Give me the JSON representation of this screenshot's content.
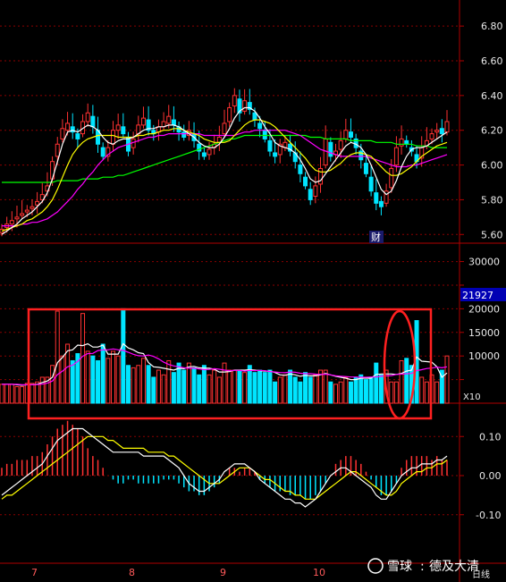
{
  "chart_data": [
    {
      "type": "candlestick",
      "panel": "price",
      "ylim": [
        5.55,
        6.95
      ],
      "y_ticks": [
        "6.80",
        "6.60",
        "6.40",
        "6.20",
        "6.00",
        "5.80",
        "5.60"
      ],
      "colors": {
        "up": "#ff3232",
        "down": "#00e5ff",
        "ma5": "#ffffff",
        "ma10": "#ffff00",
        "ma20": "#ff00ff",
        "ma60": "#00ff00"
      },
      "event_marker": "财",
      "series_close": [
        5.63,
        5.66,
        5.68,
        5.7,
        5.72,
        5.74,
        5.76,
        5.79,
        5.83,
        5.88,
        6.02,
        6.12,
        6.21,
        6.24,
        6.19,
        6.15,
        6.25,
        6.3,
        6.22,
        6.12,
        6.05,
        6.1,
        6.2,
        6.23,
        6.18,
        6.08,
        6.15,
        6.23,
        6.27,
        6.2,
        6.18,
        6.22,
        6.25,
        6.28,
        6.23,
        6.19,
        6.16,
        6.2,
        6.14,
        6.08,
        6.05,
        6.09,
        6.12,
        6.16,
        6.24,
        6.33,
        6.4,
        6.3,
        6.37,
        6.32,
        6.26,
        6.21,
        6.15,
        6.08,
        6.05,
        6.12,
        6.13,
        6.08,
        6.02,
        5.95,
        5.88,
        5.8,
        5.88,
        5.98,
        6.15,
        6.05,
        6.08,
        6.14,
        6.2,
        6.16,
        6.1,
        6.03,
        5.95,
        5.85,
        5.78,
        5.76,
        5.85,
        5.98,
        6.1,
        6.15,
        6.12,
        6.08,
        6.02,
        6.1,
        6.14,
        6.18,
        6.2,
        6.18,
        6.25
      ],
      "series_open": [
        5.61,
        5.64,
        5.66,
        5.69,
        5.71,
        5.73,
        5.75,
        5.77,
        5.8,
        5.85,
        5.92,
        6.05,
        6.15,
        6.2,
        6.22,
        6.18,
        6.18,
        6.25,
        6.28,
        6.2,
        6.1,
        6.05,
        6.12,
        6.2,
        6.22,
        6.16,
        6.1,
        6.18,
        6.23,
        6.26,
        6.2,
        6.19,
        6.22,
        6.24,
        6.26,
        6.22,
        6.19,
        6.17,
        6.18,
        6.12,
        6.07,
        6.06,
        6.1,
        6.13,
        6.18,
        6.25,
        6.34,
        6.38,
        6.31,
        6.36,
        6.3,
        6.24,
        6.2,
        6.14,
        6.07,
        6.06,
        6.1,
        6.12,
        6.07,
        6.0,
        5.93,
        5.86,
        5.82,
        5.89,
        6.0,
        6.13,
        6.06,
        6.09,
        6.15,
        6.19,
        6.15,
        6.08,
        6.01,
        5.93,
        5.84,
        5.79,
        5.78,
        5.87,
        6.0,
        6.11,
        6.14,
        6.1,
        6.06,
        6.04,
        6.11,
        6.15,
        6.19,
        6.21,
        6.19
      ],
      "ma5": [
        5.6,
        5.62,
        5.64,
        5.66,
        5.69,
        5.71,
        5.73,
        5.76,
        5.79,
        5.84,
        5.92,
        6.02,
        6.12,
        6.19,
        6.2,
        6.19,
        6.21,
        6.23,
        6.22,
        6.2,
        6.16,
        6.13,
        6.12,
        6.14,
        6.15,
        6.15,
        6.16,
        6.18,
        6.2,
        6.21,
        6.21,
        6.22,
        6.22,
        6.23,
        6.23,
        6.22,
        6.2,
        6.18,
        6.16,
        6.13,
        6.11,
        6.1,
        6.1,
        6.12,
        6.16,
        6.21,
        6.27,
        6.31,
        6.33,
        6.33,
        6.31,
        6.27,
        6.22,
        6.18,
        6.13,
        6.11,
        6.1,
        6.09,
        6.07,
        6.03,
        5.98,
        5.92,
        5.9,
        5.91,
        5.95,
        5.99,
        6.03,
        6.07,
        6.11,
        6.13,
        6.12,
        6.1,
        6.06,
        6.0,
        5.93,
        5.86,
        5.83,
        5.85,
        5.91,
        5.99,
        6.05,
        6.09,
        6.1,
        6.1,
        6.11,
        6.13,
        6.15,
        6.17,
        6.19
      ],
      "ma10": [
        5.62,
        5.63,
        5.64,
        5.65,
        5.66,
        5.68,
        5.69,
        5.71,
        5.73,
        5.76,
        5.8,
        5.86,
        5.93,
        6.0,
        6.06,
        6.1,
        6.13,
        6.15,
        6.16,
        6.17,
        6.17,
        6.17,
        6.17,
        6.16,
        6.16,
        6.16,
        6.16,
        6.17,
        6.17,
        6.18,
        6.18,
        6.19,
        6.2,
        6.2,
        6.21,
        6.21,
        6.2,
        6.19,
        6.18,
        6.17,
        6.15,
        6.14,
        6.13,
        6.13,
        6.13,
        6.14,
        6.17,
        6.2,
        6.23,
        6.25,
        6.26,
        6.26,
        6.25,
        6.24,
        6.22,
        6.19,
        6.16,
        6.13,
        6.1,
        6.07,
        6.04,
        6.0,
        5.97,
        5.96,
        5.96,
        5.97,
        5.99,
        6.01,
        6.04,
        6.06,
        6.07,
        6.07,
        6.06,
        6.05,
        6.02,
        5.99,
        5.96,
        5.94,
        5.94,
        5.95,
        5.97,
        5.99,
        6.02,
        6.05,
        6.07,
        6.09,
        6.11,
        6.12,
        6.13
      ],
      "ma20": [
        5.65,
        5.65,
        5.65,
        5.65,
        5.66,
        5.66,
        5.67,
        5.67,
        5.68,
        5.69,
        5.71,
        5.73,
        5.76,
        5.79,
        5.82,
        5.86,
        5.89,
        5.93,
        5.96,
        6.0,
        6.03,
        6.06,
        6.08,
        6.1,
        6.11,
        6.12,
        6.13,
        6.14,
        6.15,
        6.16,
        6.16,
        6.17,
        6.17,
        6.18,
        6.18,
        6.18,
        6.18,
        6.18,
        6.18,
        6.18,
        6.17,
        6.17,
        6.17,
        6.17,
        6.17,
        6.17,
        6.17,
        6.18,
        6.19,
        6.19,
        6.2,
        6.2,
        6.2,
        6.2,
        6.2,
        6.2,
        6.2,
        6.19,
        6.18,
        6.17,
        6.15,
        6.13,
        6.11,
        6.09,
        6.08,
        6.07,
        6.06,
        6.05,
        6.05,
        6.05,
        6.05,
        6.05,
        6.05,
        6.04,
        6.03,
        6.02,
        6.01,
        6.0,
        5.99,
        5.99,
        5.99,
        6.0,
        6.0,
        6.01,
        6.02,
        6.03,
        6.04,
        6.05,
        6.06
      ],
      "ma60": [
        5.9,
        5.9,
        5.9,
        5.9,
        5.9,
        5.9,
        5.9,
        5.9,
        5.9,
        5.9,
        5.9,
        5.91,
        5.91,
        5.91,
        5.91,
        5.91,
        5.92,
        5.92,
        5.92,
        5.92,
        5.93,
        5.93,
        5.93,
        5.94,
        5.94,
        5.95,
        5.96,
        5.97,
        5.98,
        5.99,
        6.0,
        6.01,
        6.02,
        6.03,
        6.04,
        6.05,
        6.06,
        6.07,
        6.08,
        6.09,
        6.1,
        6.11,
        6.12,
        6.13,
        6.14,
        6.15,
        6.15,
        6.16,
        6.17,
        6.17,
        6.17,
        6.17,
        6.17,
        6.17,
        6.17,
        6.17,
        6.17,
        6.17,
        6.17,
        6.17,
        6.17,
        6.16,
        6.16,
        6.16,
        6.15,
        6.15,
        6.15,
        6.15,
        6.15,
        6.14,
        6.14,
        6.14,
        6.14,
        6.14,
        6.13,
        6.13,
        6.13,
        6.13,
        6.12,
        6.12,
        6.12,
        6.12,
        6.11,
        6.11,
        6.11,
        6.1,
        6.1,
        6.1,
        6.1
      ]
    },
    {
      "type": "bar",
      "panel": "volume",
      "ylim": [
        0,
        32000
      ],
      "y_ticks": [
        "30000",
        "25000",
        "20000",
        "15000",
        "10000",
        "5000"
      ],
      "current_value_label": "21927",
      "unit_label": "X10",
      "values": [
        4000,
        4000,
        4000,
        3500,
        3500,
        4200,
        4200,
        4500,
        5500,
        5500,
        8000,
        19500,
        10000,
        12500,
        9000,
        10500,
        19000,
        11000,
        10000,
        9000,
        12500,
        9500,
        11000,
        10000,
        20000,
        8000,
        7500,
        8000,
        9500,
        8000,
        5500,
        7000,
        6000,
        9000,
        6500,
        8500,
        7000,
        8500,
        7500,
        6000,
        8000,
        6000,
        7000,
        5500,
        8500,
        7000,
        7000,
        7000,
        6500,
        8000,
        6500,
        7000,
        6500,
        7000,
        4500,
        5500,
        6000,
        7000,
        5500,
        4500,
        6500,
        5500,
        6000,
        7000,
        7000,
        4500,
        4000,
        4500,
        5500,
        4500,
        5500,
        6000,
        5000,
        5500,
        8500,
        6000,
        7000,
        4500,
        4500,
        9000,
        9500,
        8000,
        17500,
        5500,
        4500,
        6000,
        4500,
        7000,
        10000
      ],
      "ma5": [
        4000,
        4000,
        4000,
        3900,
        3800,
        3900,
        3900,
        4000,
        4400,
        4700,
        5500,
        8600,
        9700,
        11100,
        11300,
        12300,
        12200,
        12600,
        11900,
        11900,
        12300,
        10400,
        10400,
        10400,
        12600,
        11700,
        11300,
        10700,
        10500,
        8600,
        7700,
        7600,
        7400,
        7200,
        7000,
        7400,
        7300,
        7700,
        7800,
        7500,
        7400,
        7400,
        7200,
        6600,
        6600,
        6700,
        7000,
        7000,
        7000,
        7100,
        7000,
        6900,
        6800,
        6800,
        6500,
        6000,
        5900,
        6200,
        6000,
        5700,
        5900,
        5800,
        5800,
        6000,
        6300,
        6000,
        5700,
        5500,
        5300,
        5000,
        5000,
        5300,
        5300,
        5300,
        6100,
        6200,
        6200,
        6200,
        6100,
        6300,
        6800,
        7000,
        9800,
        8900,
        8800,
        8700,
        7700,
        5500,
        6400
      ],
      "ma10": [
        4000,
        4000,
        4000,
        4000,
        3900,
        3900,
        3900,
        3950,
        4050,
        4250,
        4700,
        6050,
        6800,
        7700,
        8050,
        8850,
        9950,
        10500,
        10550,
        11150,
        11300,
        11300,
        11500,
        11300,
        11200,
        10800,
        10350,
        10050,
        10000,
        10200,
        9900,
        9400,
        8700,
        8200,
        7900,
        7700,
        7500,
        7400,
        7400,
        7250,
        7100,
        7150,
        7300,
        7200,
        7000,
        6900,
        6950,
        6950,
        6800,
        6950,
        6900,
        6950,
        6900,
        6700,
        6600,
        6500,
        6450,
        6600,
        6550,
        6350,
        6250,
        6250,
        6150,
        6100,
        6150,
        6000,
        5800,
        5700,
        5650,
        5550,
        5550,
        5500,
        5500,
        5550,
        5550,
        5700,
        5800,
        5850,
        6100,
        6150,
        6250,
        6300,
        6900,
        7100,
        7350,
        7450,
        7650,
        7500,
        7700
      ]
    },
    {
      "type": "line+bar",
      "panel": "macd",
      "ylim": [
        -0.16,
        0.16
      ],
      "y_ticks": [
        "0.10",
        "0.00",
        "-0.10"
      ],
      "histogram": [
        0.02,
        0.03,
        0.03,
        0.04,
        0.04,
        0.04,
        0.05,
        0.05,
        0.06,
        0.08,
        0.1,
        0.12,
        0.13,
        0.14,
        0.13,
        0.12,
        0.1,
        0.07,
        0.05,
        0.04,
        0.02,
        0.0,
        -0.01,
        -0.02,
        -0.02,
        -0.01,
        -0.01,
        -0.02,
        -0.02,
        -0.02,
        -0.02,
        -0.02,
        -0.01,
        -0.01,
        -0.01,
        -0.02,
        -0.03,
        -0.04,
        -0.04,
        -0.05,
        -0.05,
        -0.04,
        -0.03,
        -0.02,
        0.0,
        0.02,
        0.02,
        0.01,
        0.02,
        0.02,
        0.01,
        -0.01,
        -0.02,
        -0.03,
        -0.04,
        -0.04,
        -0.04,
        -0.05,
        -0.05,
        -0.05,
        -0.06,
        -0.06,
        -0.05,
        -0.04,
        -0.02,
        0.0,
        0.03,
        0.04,
        0.05,
        0.05,
        0.04,
        0.03,
        0.01,
        -0.01,
        -0.03,
        -0.05,
        -0.05,
        -0.04,
        -0.02,
        0.02,
        0.04,
        0.05,
        0.05,
        0.05,
        0.05,
        0.04,
        0.05,
        0.04,
        0.04
      ],
      "dif": [
        -0.05,
        -0.04,
        -0.03,
        -0.02,
        -0.01,
        0.0,
        0.01,
        0.02,
        0.03,
        0.05,
        0.07,
        0.09,
        0.1,
        0.11,
        0.12,
        0.12,
        0.12,
        0.11,
        0.1,
        0.09,
        0.08,
        0.07,
        0.06,
        0.06,
        0.06,
        0.06,
        0.06,
        0.06,
        0.05,
        0.05,
        0.05,
        0.05,
        0.05,
        0.04,
        0.03,
        0.02,
        0.0,
        -0.02,
        -0.03,
        -0.04,
        -0.04,
        -0.03,
        -0.02,
        -0.01,
        0.01,
        0.02,
        0.03,
        0.03,
        0.03,
        0.02,
        0.01,
        -0.01,
        -0.02,
        -0.03,
        -0.04,
        -0.05,
        -0.06,
        -0.06,
        -0.07,
        -0.07,
        -0.08,
        -0.07,
        -0.06,
        -0.04,
        -0.02,
        0.0,
        0.01,
        0.02,
        0.02,
        0.01,
        0.0,
        -0.01,
        -0.02,
        -0.03,
        -0.05,
        -0.06,
        -0.06,
        -0.04,
        -0.02,
        0.0,
        0.01,
        0.02,
        0.02,
        0.03,
        0.03,
        0.03,
        0.04,
        0.04,
        0.05
      ],
      "dea": [
        -0.06,
        -0.05,
        -0.05,
        -0.04,
        -0.03,
        -0.02,
        -0.01,
        0.0,
        0.01,
        0.02,
        0.03,
        0.04,
        0.05,
        0.06,
        0.07,
        0.08,
        0.09,
        0.1,
        0.1,
        0.1,
        0.1,
        0.09,
        0.09,
        0.08,
        0.07,
        0.07,
        0.07,
        0.07,
        0.07,
        0.06,
        0.06,
        0.06,
        0.06,
        0.05,
        0.05,
        0.04,
        0.03,
        0.02,
        0.01,
        0.0,
        -0.01,
        -0.02,
        -0.02,
        -0.02,
        -0.01,
        0.0,
        0.01,
        0.02,
        0.02,
        0.02,
        0.01,
        0.0,
        -0.01,
        -0.01,
        -0.02,
        -0.03,
        -0.04,
        -0.04,
        -0.05,
        -0.05,
        -0.06,
        -0.06,
        -0.06,
        -0.05,
        -0.04,
        -0.03,
        -0.02,
        -0.01,
        0.0,
        0.01,
        0.01,
        0.0,
        -0.01,
        -0.02,
        -0.03,
        -0.04,
        -0.05,
        -0.05,
        -0.04,
        -0.02,
        -0.01,
        0.0,
        0.01,
        0.01,
        0.02,
        0.02,
        0.03,
        0.03,
        0.04
      ]
    }
  ],
  "x_axis": {
    "labels": [
      "7",
      "8",
      "9",
      "10"
    ],
    "period": "日线"
  },
  "watermark": {
    "brand": "雪球",
    "author": "德及大清"
  }
}
